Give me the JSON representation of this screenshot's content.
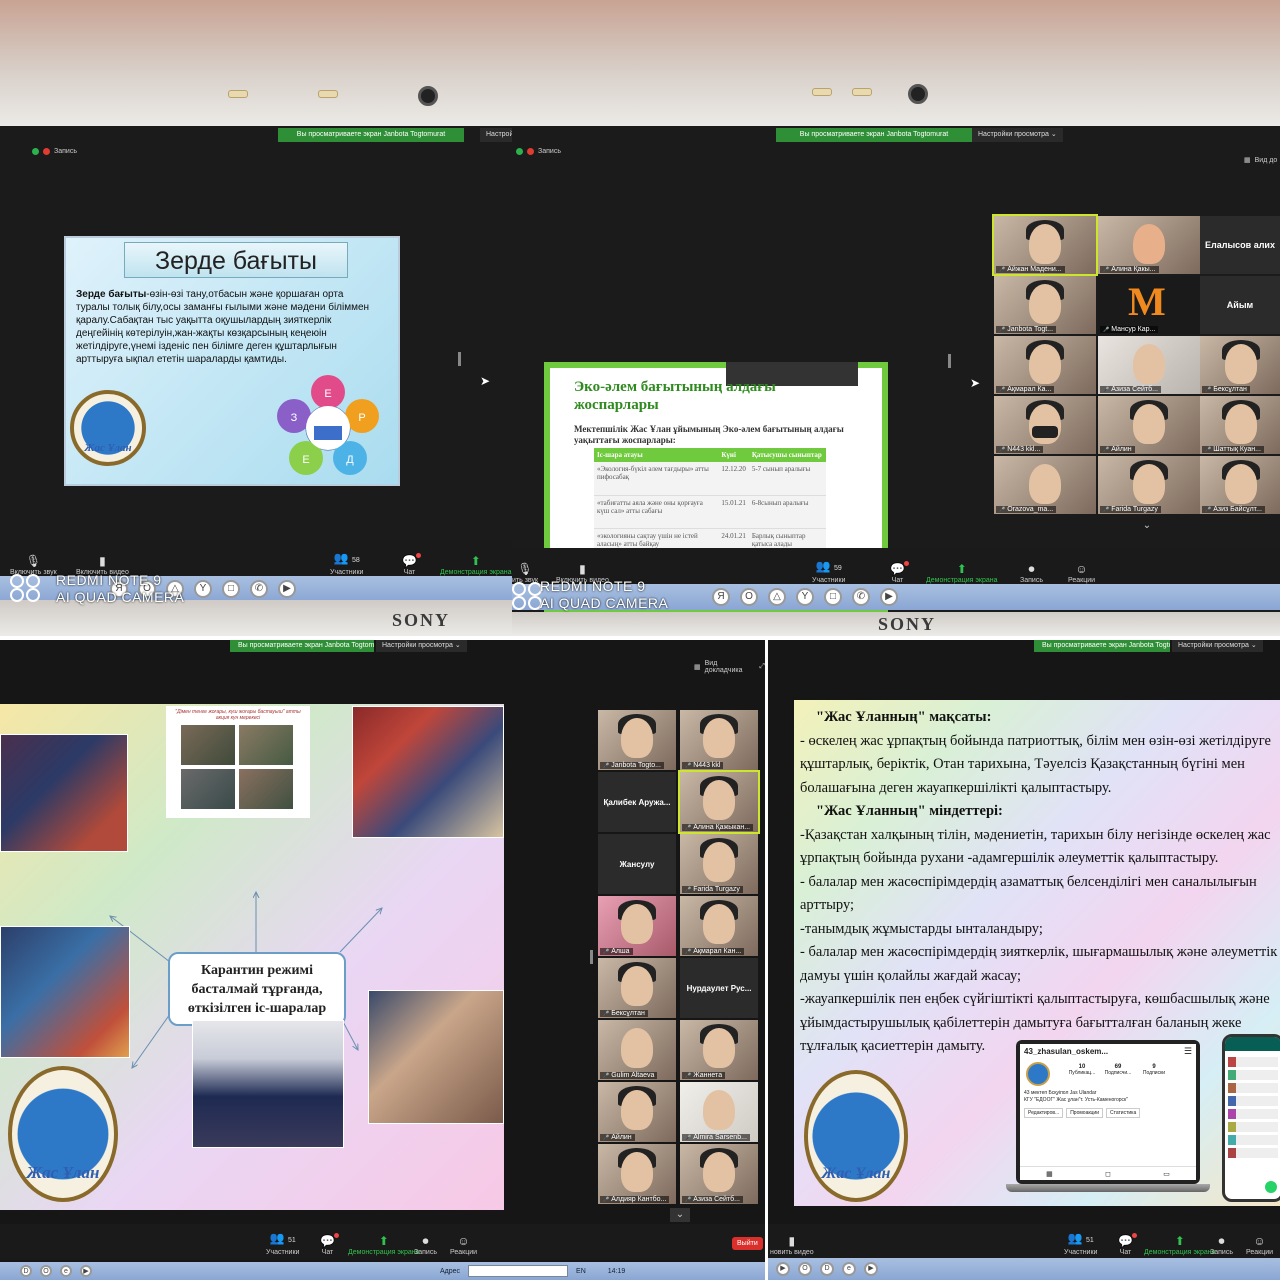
{
  "q1": {
    "share_banner": "Вы просматриваете экран Janbota Togtomurat",
    "view_settings": "Настрой",
    "recording": "Запись",
    "slide": {
      "title": "Зерде бағыты",
      "text_bold": "Зерде бағыты",
      "text": "-өзін-өзі тану,отбасын және қоршаған орта туралы толық білу,осы заманғы ғылыми және мәдени біліммен қаралу.Сабақтан тыс уақытта оқушылардың зияткерлік деңгейінің көтерілуін,жан-жақты көзқарсының кеңеюін жетілдіруге,үнемі ізденіс пен білімге деген құштарлығын арттыруға ықпал ететін шараларды қамтиды.",
      "logo_text": "Жас Ұлан",
      "wheel_letters": [
        "З",
        "Е",
        "Р",
        "Д",
        "Е"
      ]
    },
    "toolbar": {
      "mic": "Включить звук",
      "video": "Включить видео",
      "participants": "Участники",
      "participants_count": "58",
      "chat": "Чат",
      "share": "Демонстрация экрана"
    },
    "watermark": [
      "REDMI NOTE 9",
      "AI QUAD CAMERA"
    ],
    "brand": "SONY"
  },
  "q2": {
    "share_banner": "Вы просматриваете экран Janbota Togtomurat",
    "view_settings": "Настройки просмотра ⌄",
    "recording": "Запись",
    "speaker_view": "Вид до",
    "slide": {
      "title": "Эко-әлем бағытының алдағы жоспарлары",
      "subtitle": "Мектепшілік Жас Ұлан ұйымының Эко-әлем бағытының алдағы уақыттағы жоспарлары:",
      "headers": [
        "Іс-шара атауы",
        "Күні",
        "Қатысушы сыныптар"
      ],
      "rows": [
        [
          "«Экология-бүкіл әлем тағдыры» атты пифосабақ",
          "12.12.20",
          "5-7 сынып аралығы"
        ],
        [
          "«табиғатты аяла және оны қорғауға күш сал» атты сабағы",
          "15.01.21",
          "6-8сынып аралығы"
        ],
        [
          "«экологияны сақтау үшін не істей аласың» атты байқау",
          "24.01.21",
          "Барлық сыныптар қатыса алады"
        ]
      ]
    },
    "participants": [
      "Айжан Мадени...",
      "Алина Қакы...",
      "Елалысов алих",
      "Janbota Togt...",
      "Мансур Кар...",
      "Айым",
      "Ақмарал Ка...",
      "Азиза Сейтб...",
      "Бексұлтан",
      "N443 kkl...",
      "Айлин",
      "Шаттық Куан...",
      "Orazova_ma...",
      "Farida Turgazy",
      "Азиз Байсұлт..."
    ],
    "toolbar": {
      "mic": "ить звук",
      "video": "Включить видео",
      "participants": "Участники",
      "participants_count": "59",
      "chat": "Чат",
      "share": "Демонстрация экрана",
      "record": "Запись",
      "reactions": "Реакции"
    },
    "watermark": [
      "REDMI NOTE 9",
      "AI QUAD CAMERA"
    ],
    "brand": "SONY"
  },
  "q3": {
    "share_banner": "Вы просматриваете экран Janbota Togtomurat",
    "view_settings": "Настройки просмотра ⌄",
    "speaker_view": "Вид докладчика",
    "center_box": "Карантин режимі басталмай тұрғанда, өткізілген іс-шаралар",
    "photo_caption": "\"Дімен тенге жоғары, күш жоғары бастауыш\" атты акция күн мерекесі",
    "logo_text": "Жас Ұлан",
    "participants": [
      "Janbota Togto...",
      "N443 kkl",
      "Қалибек Аружа...",
      "Алина Қажыкан...",
      "Жансулу",
      "Farida Turgazy",
      "Алша",
      "Ақмарал Кан...",
      "Бексұлтан",
      "Нурдаулет Рус...",
      "Gulim Altaeva",
      "Жаннета",
      "Айлин",
      "Almira Sarsenb...",
      "Алдияр Кантбо...",
      "Азиза Сейтб..."
    ],
    "toolbar": {
      "participants": "Участники",
      "participants_count": "51",
      "chat": "Чат",
      "share": "Демонстрация экрана",
      "record": "Запись",
      "reactions": "Реакции",
      "leave": "Выйти"
    },
    "taskbar": {
      "address_label": "Адрес",
      "lang": "EN",
      "time": "14:19"
    }
  },
  "q4": {
    "share_banner": "Вы просматриваете экран Janbota Togtomurat",
    "view_settings": "Настройки просмотра ⌄",
    "lines": [
      {
        "hd": true,
        "text": "\"Жас Ұланның\" мақсаты:"
      },
      {
        "hd": false,
        "text": "-   өскелең жас ұрпақтың бойында патриоттық, білім мен өзін-өзі жетілдіруге"
      },
      {
        "hd": false,
        "text": "құштарлық, беріктік, Отан тарихына, Тәуелсіз Қазақстанның бүгіні мен"
      },
      {
        "hd": false,
        "text": " болашағына деген жауапкершілікті қалыптастыру."
      },
      {
        "hd": true,
        "text": "\"Жас Ұланның\" міндеттері:"
      },
      {
        "hd": false,
        "text": "-Қазақстан халқының тілін, мәдениетін, тарихын білу негізінде өскелең жас"
      },
      {
        "hd": false,
        "text": "ұрпақтың бойында рухани -адамгершілік әлеуметтік қалыптастыру."
      },
      {
        "hd": false,
        "text": "-   балалар мен жасөспірімдердің  азаматтық белсенділігі мен саналылығын"
      },
      {
        "hd": false,
        "text": " арттыру;"
      },
      {
        "hd": false,
        "text": "-танымдық жұмыстарды ынталандыру;"
      },
      {
        "hd": false,
        "text": "- балалар мен жасөспірімдердің  зияткерлік, шығармашылық  және әлеуметтік"
      },
      {
        "hd": false,
        "text": "дамуы үшін қолайлы жағдай жасау;"
      },
      {
        "hd": false,
        "text": "-жауапкершілік пен еңбек сүйгіштікті қалыптастыруға, көшбасшылық және"
      },
      {
        "hd": false,
        "text": " ұйымдастырушылық қабілеттерін  дамытуға бағытталған баланың жеке"
      },
      {
        "hd": false,
        "text": "тұлғалық қасиеттерін дамыту."
      }
    ],
    "insta": {
      "username": "43_zhasulan_oskem...",
      "posts": "10",
      "followers": "69",
      "following": "9",
      "posts_lbl": "Публикац...",
      "followers_lbl": "Подписчи...",
      "following_lbl": "Подписки",
      "bio": "43 мектеп Бсқуіпол Jas Ulandar",
      "bio2": "КГУ \"ЕДООГ\" Жас ұлан\"т. Усть-Каменогорск\"",
      "btn1": "Редактиров...",
      "btn2": "Промоакции",
      "btn3": "Статистика"
    },
    "logo_text": "Жас Ұлан",
    "toolbar": {
      "video": "новить видео",
      "participants": "Участники",
      "participants_count": "51",
      "chat": "Чат",
      "share": "Демонстрация экрана",
      "record": "Запись",
      "reactions": "Реакции"
    }
  }
}
